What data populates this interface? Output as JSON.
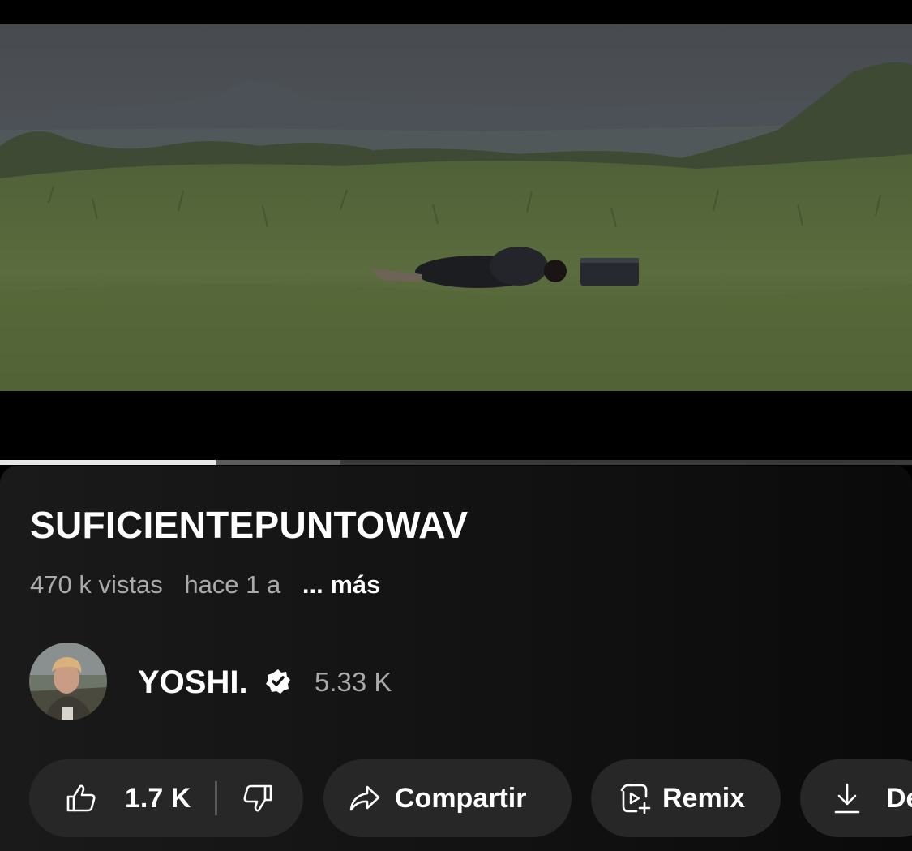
{
  "video": {
    "title": "SUFICIENTEPUNTOWAV",
    "views": "470 k vistas",
    "age": "hace 1 a",
    "more_label": "... más",
    "progress_played": 0.236,
    "progress_buffered": 0.373
  },
  "channel": {
    "name": "YOSHI.",
    "subscribers": "5.33 K",
    "verified_icon": "verified-badge-icon"
  },
  "actions": {
    "like_count": "1.7 K",
    "share_label": "Compartir",
    "remix_label": "Remix",
    "download_label": "De"
  },
  "icons": {
    "like": "thumb-up-icon",
    "dislike": "thumb-down-icon",
    "share": "share-arrow-icon",
    "remix": "remix-icon",
    "download": "download-icon"
  },
  "colors": {
    "background": "#000000",
    "panel": "#121212",
    "pill": "#272727",
    "secondary_text": "#aaaaaa",
    "progress_played": "#e6e6e6"
  }
}
